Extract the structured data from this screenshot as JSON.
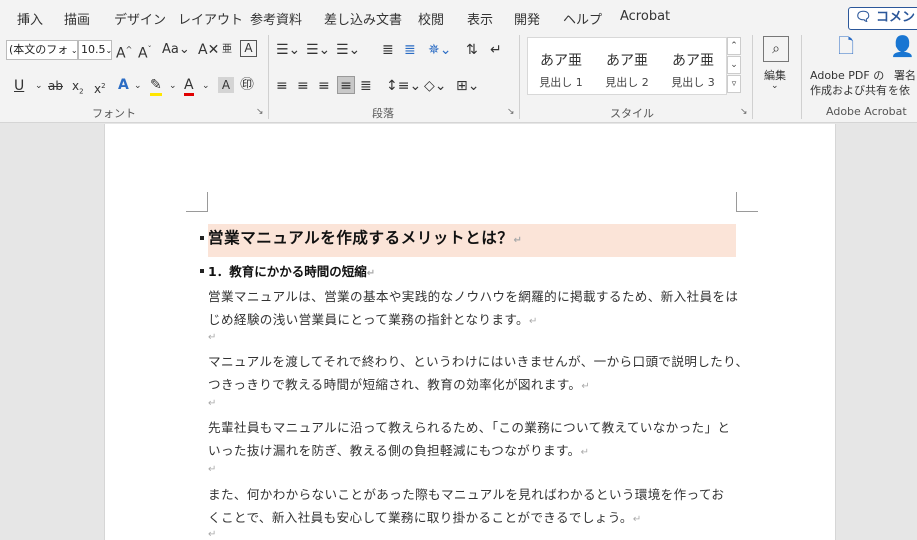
{
  "tabs": {
    "insert": "挿入",
    "draw": "描画",
    "design": "デザイン",
    "layout": "レイアウト",
    "references": "参考資料",
    "mailings": "差し込み文書",
    "review": "校閲",
    "view": "表示",
    "developer": "開発",
    "help": "ヘルプ",
    "acrobat": "Acrobat",
    "comments": "コメント"
  },
  "font_group": {
    "font_name": "(本文のフォ",
    "font_size": "10.5",
    "label": "フォント"
  },
  "paragraph_group": {
    "label": "段落"
  },
  "styles_group": {
    "label": "スタイル",
    "items": [
      {
        "sample": "あア亜",
        "name": "見出し 1"
      },
      {
        "sample": "あア亜",
        "name": "見出し 2"
      },
      {
        "sample": "あア亜",
        "name": "見出し 3"
      }
    ]
  },
  "editing": {
    "label": "編集"
  },
  "acrobat_group": {
    "create_share_line1": "Adobe PDF の",
    "create_share_line2": "作成および共有",
    "request_line1": "署名",
    "request_line2": "を依",
    "label": "Adobe Acrobat"
  },
  "document": {
    "heading": "営業マニュアルを作成するメリットとは？",
    "subheading": "1．教育にかかる時間の短縮",
    "paragraphs": [
      [
        "営業マニュアルは、営業の基本や実践的なノウハウを網羅的に掲載するため、新入社員をは",
        "じめ経験の浅い営業員にとって業務の指針となります。"
      ],
      [
        "マニュアルを渡してそれで終わり、というわけにはいきませんが、一から口頭で説明したり、",
        "つきっきりで教える時間が短縮され、教育の効率化が図れます。"
      ],
      [
        "先輩社員もマニュアルに沿って教えられるため、「この業務について教えていなかった」と",
        "いった抜け漏れを防ぎ、教える側の負担軽減にもつながります。"
      ],
      [
        "また、何かわからないことがあった際もマニュアルを見ればわかるという環境を作ってお",
        "くことで、新入社員も安心して業務に取り掛かることができるでしょう。"
      ]
    ],
    "para_mark": "↵"
  }
}
